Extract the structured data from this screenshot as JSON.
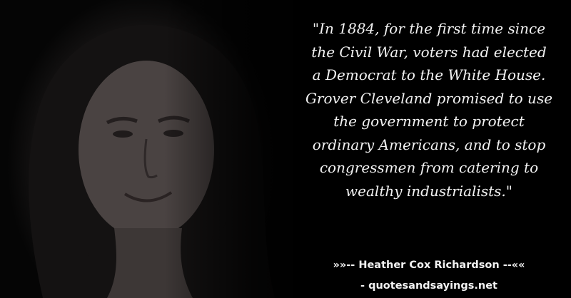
{
  "quote": {
    "lines": [
      "\"In 1884, for the first time since",
      "the Civil War, voters had elected",
      "a Democrat to the White House.",
      "Grover Cleveland promised to use",
      "the government to protect",
      "ordinary Americans, and to stop",
      "congressmen from catering to",
      "wealthy industrialists.\""
    ]
  },
  "attribution": {
    "author_line": "»»-- Heather Cox Richardson --««",
    "site_line": "- quotesandsayings.net"
  },
  "colors": {
    "background": "#000000",
    "text": "#f2f2f2"
  }
}
